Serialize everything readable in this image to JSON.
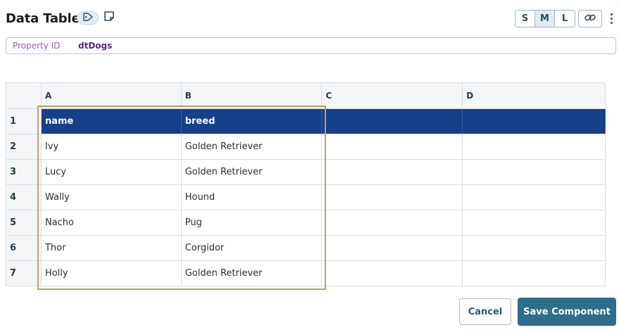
{
  "header": {
    "title": "Data Table",
    "size_options": [
      "S",
      "M",
      "L"
    ],
    "active_size": "M"
  },
  "property": {
    "label": "Property ID",
    "value": "dtDogs"
  },
  "grid": {
    "columns": [
      "A",
      "B",
      "C",
      "D"
    ],
    "rows": [
      {
        "num": "1",
        "cells": [
          "name",
          "breed",
          "",
          ""
        ]
      },
      {
        "num": "2",
        "cells": [
          "Ivy",
          "Golden Retriever",
          "",
          ""
        ]
      },
      {
        "num": "3",
        "cells": [
          "Lucy",
          "Golden Retriever",
          "",
          ""
        ]
      },
      {
        "num": "4",
        "cells": [
          "Wally",
          "Hound",
          "",
          ""
        ]
      },
      {
        "num": "5",
        "cells": [
          "Nacho",
          "Pug",
          "",
          ""
        ]
      },
      {
        "num": "6",
        "cells": [
          "Thor",
          "Corgidor",
          "",
          ""
        ]
      },
      {
        "num": "7",
        "cells": [
          "Holly",
          "Golden Retriever",
          "",
          ""
        ]
      }
    ]
  },
  "footer": {
    "cancel_label": "Cancel",
    "save_label": "Save Component"
  },
  "colors": {
    "header_row_bg": "#17408a",
    "primary_button": "#2f6e8a",
    "selection_border": "#b9a06a"
  },
  "icons": {
    "tag": "tag-icon",
    "note": "note-icon",
    "link": "link-icon",
    "more": "more-vertical-icon"
  }
}
